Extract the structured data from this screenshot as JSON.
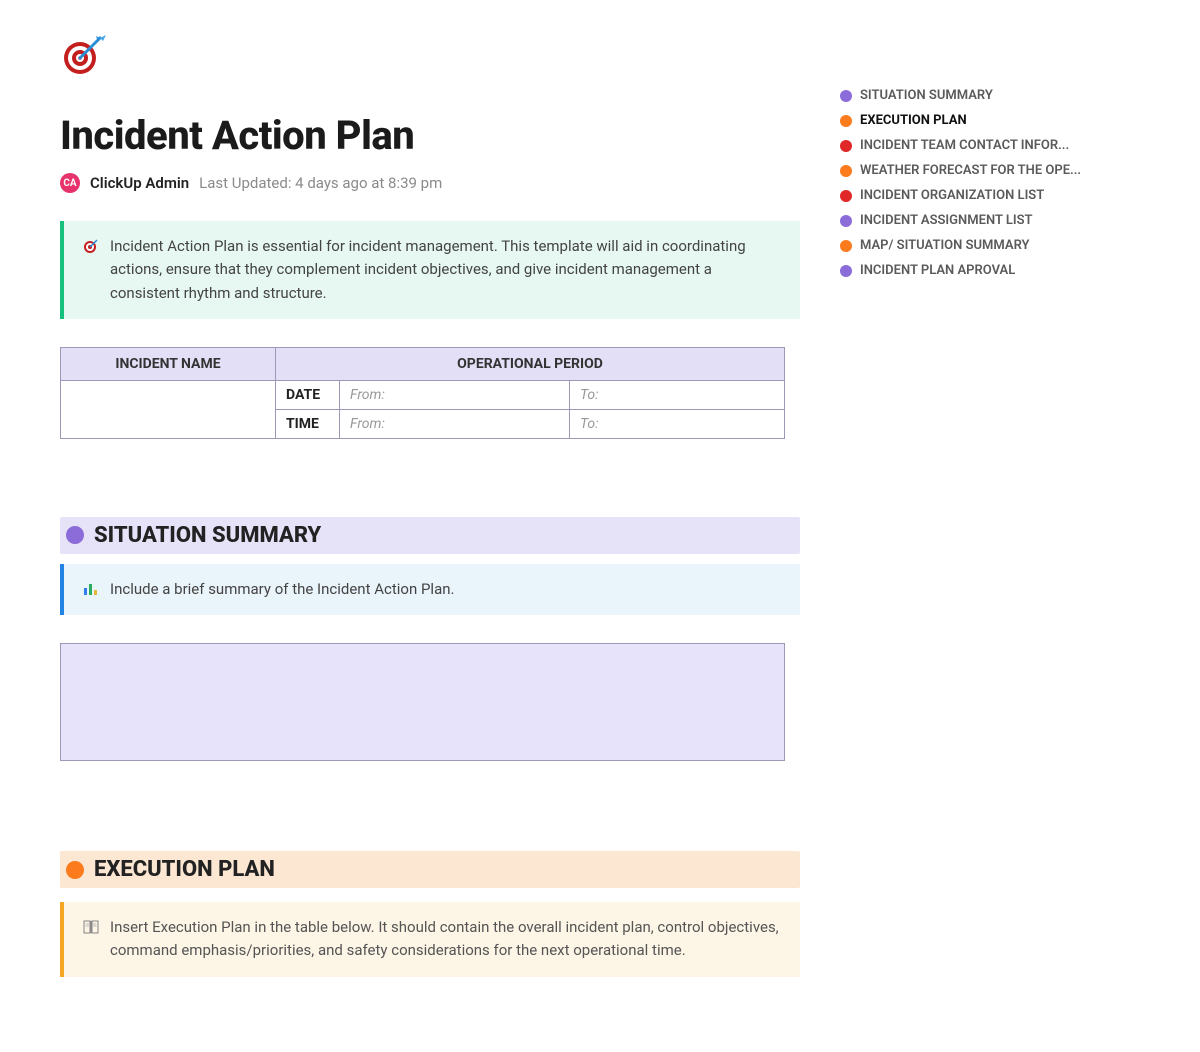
{
  "header": {
    "title": "Incident Action Plan",
    "avatar_initials": "CA",
    "author": "ClickUp Admin",
    "last_updated": "Last Updated: 4 days ago at 8:39 pm"
  },
  "intro_callout": "Incident Action Plan is essential for incident management. This template will aid in coordinating actions, ensure that they complement incident objectives, and give incident management a consistent rhythm and structure.",
  "info_table": {
    "col1": "INCIDENT NAME",
    "col2": "OPERATIONAL PERIOD",
    "row_date_label": "DATE",
    "row_time_label": "TIME",
    "from_label": "From:",
    "to_label": "To:"
  },
  "sections": {
    "situation": {
      "title": "SITUATION SUMMARY",
      "hint": "Include a brief summary of the Incident Action Plan."
    },
    "execution": {
      "title": "EXECUTION PLAN",
      "hint": "Insert Execution Plan in the table below. It should contain the overall incident plan, control objectives, command emphasis/priorities, and safety considerations for the next operational time."
    }
  },
  "toc": [
    {
      "label": "SITUATION SUMMARY",
      "color": "#8b6cd8",
      "active": false
    },
    {
      "label": "EXECUTION PLAN",
      "color": "#fb7b1d",
      "active": true
    },
    {
      "label": "INCIDENT TEAM CONTACT INFOR...",
      "color": "#e02828",
      "active": false
    },
    {
      "label": "WEATHER FORECAST FOR THE OPE...",
      "color": "#fb7b1d",
      "active": false
    },
    {
      "label": "INCIDENT ORGANIZATION LIST",
      "color": "#e02828",
      "active": false
    },
    {
      "label": "INCIDENT ASSIGNMENT LIST",
      "color": "#8b6cd8",
      "active": false
    },
    {
      "label": "MAP/ SITUATION SUMMARY",
      "color": "#fb7b1d",
      "active": false
    },
    {
      "label": "INCIDENT PLAN APROVAL",
      "color": "#8b6cd8",
      "active": false
    }
  ]
}
